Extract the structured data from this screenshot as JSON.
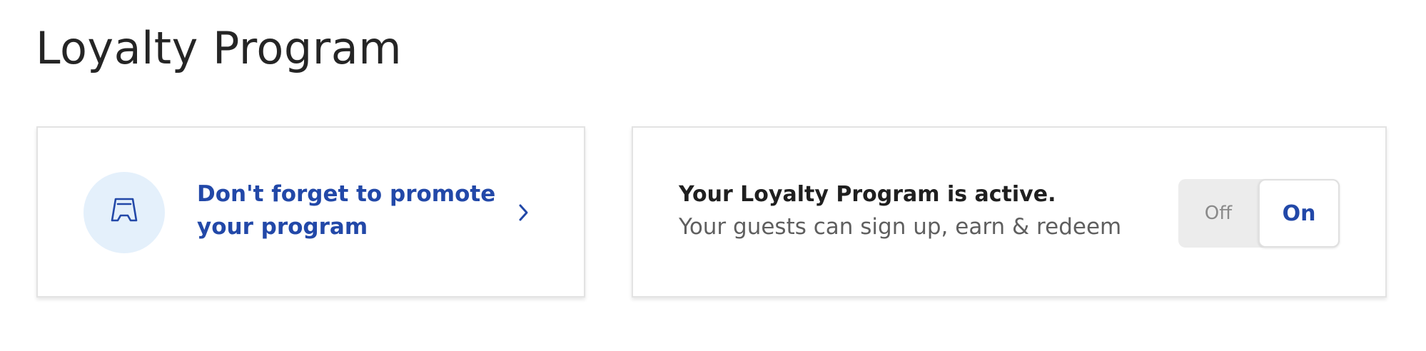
{
  "page": {
    "title": "Loyalty Program"
  },
  "promote_card": {
    "text": "Don't forget to promote your program",
    "icon": "sign-stand-icon",
    "chevron_icon": "chevron-right-icon"
  },
  "status_card": {
    "title": "Your Loyalty Program is active.",
    "subtitle": "Your guests can sign up, earn & redeem",
    "toggle": {
      "off_label": "Off",
      "on_label": "On",
      "selected": "On"
    }
  },
  "colors": {
    "accent": "#2248a8",
    "icon_circle": "#e4f0fb",
    "title_text": "#252525",
    "muted_text": "#5f5f5f",
    "toggle_track": "#ececec",
    "card_border": "#e3e3e3"
  }
}
